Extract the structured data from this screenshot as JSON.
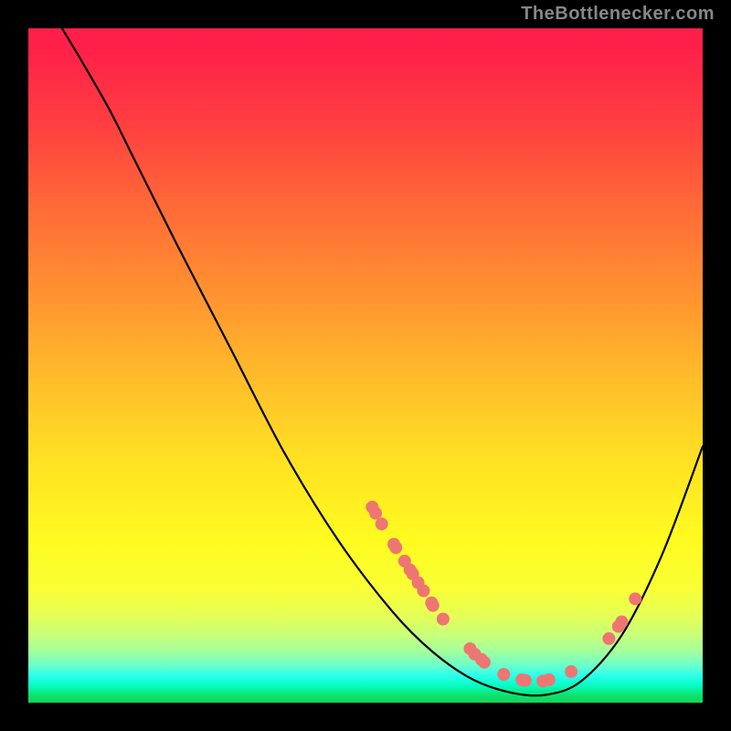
{
  "attribution": "TheBottlenecker.com",
  "chart_data": {
    "type": "line",
    "title": "",
    "xlabel": "",
    "ylabel": "",
    "xlim": [
      0,
      100
    ],
    "ylim": [
      0,
      100
    ],
    "curve": [
      {
        "x": 5.0,
        "y": 100.0
      },
      {
        "x": 8.0,
        "y": 95.0
      },
      {
        "x": 12.0,
        "y": 88.0
      },
      {
        "x": 16.0,
        "y": 80.0
      },
      {
        "x": 22.0,
        "y": 68.0
      },
      {
        "x": 30.0,
        "y": 52.5
      },
      {
        "x": 38.0,
        "y": 37.0
      },
      {
        "x": 46.0,
        "y": 24.0
      },
      {
        "x": 54.0,
        "y": 13.5
      },
      {
        "x": 60.0,
        "y": 7.5
      },
      {
        "x": 66.0,
        "y": 3.4
      },
      {
        "x": 72.0,
        "y": 1.4
      },
      {
        "x": 77.0,
        "y": 1.2
      },
      {
        "x": 82.0,
        "y": 3.2
      },
      {
        "x": 88.0,
        "y": 10.0
      },
      {
        "x": 94.0,
        "y": 22.0
      },
      {
        "x": 100.0,
        "y": 38.0
      }
    ],
    "markers": [
      {
        "x": 51.0,
        "y": 29.0
      },
      {
        "x": 51.5,
        "y": 28.1
      },
      {
        "x": 52.4,
        "y": 26.5
      },
      {
        "x": 54.2,
        "y": 23.5
      },
      {
        "x": 54.5,
        "y": 23.0
      },
      {
        "x": 55.8,
        "y": 21.0
      },
      {
        "x": 56.6,
        "y": 19.7
      },
      {
        "x": 57.0,
        "y": 19.1
      },
      {
        "x": 57.8,
        "y": 17.8
      },
      {
        "x": 58.6,
        "y": 16.6
      },
      {
        "x": 59.8,
        "y": 14.8
      },
      {
        "x": 60.0,
        "y": 14.4
      },
      {
        "x": 61.5,
        "y": 12.4
      },
      {
        "x": 65.5,
        "y": 8.0
      },
      {
        "x": 66.2,
        "y": 7.2
      },
      {
        "x": 67.2,
        "y": 6.4
      },
      {
        "x": 67.6,
        "y": 6.0
      },
      {
        "x": 70.5,
        "y": 4.2
      },
      {
        "x": 73.2,
        "y": 3.4
      },
      {
        "x": 73.7,
        "y": 3.3
      },
      {
        "x": 76.3,
        "y": 3.2
      },
      {
        "x": 77.2,
        "y": 3.4
      },
      {
        "x": 80.5,
        "y": 4.6
      },
      {
        "x": 86.1,
        "y": 9.5
      },
      {
        "x": 87.5,
        "y": 11.3
      },
      {
        "x": 88.0,
        "y": 12.0
      },
      {
        "x": 90.0,
        "y": 15.4
      }
    ],
    "marker_color": "#ee7672",
    "marker_radius_px": 7
  }
}
